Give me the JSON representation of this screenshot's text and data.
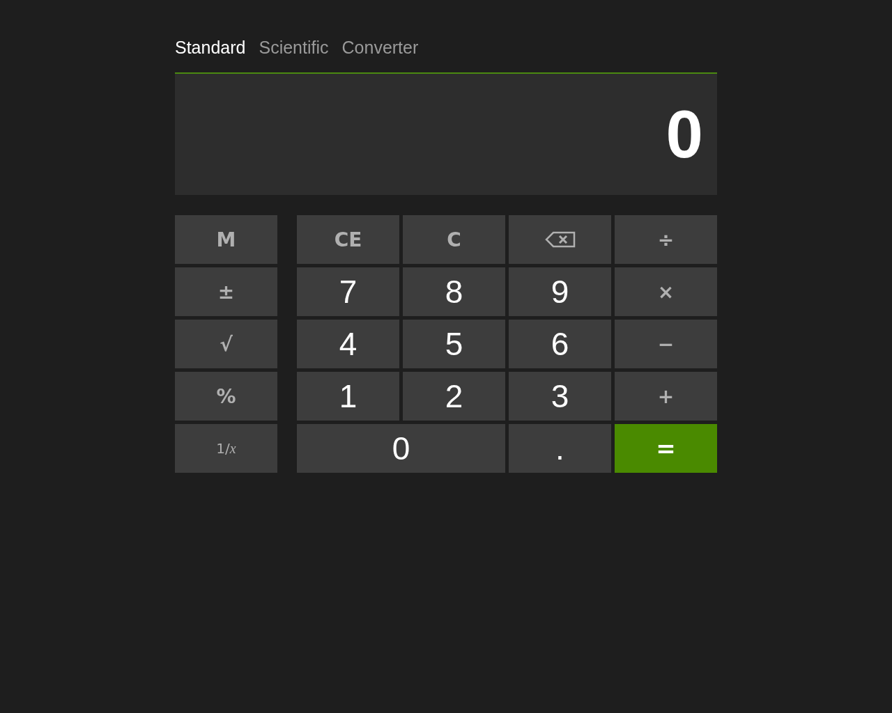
{
  "tabs": [
    {
      "label": "Standard",
      "selected": true
    },
    {
      "label": "Scientific",
      "selected": false
    },
    {
      "label": "Converter",
      "selected": false
    }
  ],
  "display": {
    "value": "0"
  },
  "memory_keys": [
    {
      "label": "M"
    },
    {
      "label": "±"
    },
    {
      "label": "√"
    },
    {
      "label": "%"
    },
    {
      "label": "1/*x*"
    }
  ],
  "keys": [
    {
      "label": "CE",
      "kind": "function"
    },
    {
      "label": "C",
      "kind": "function"
    },
    {
      "kind": "backspace"
    },
    {
      "label": "÷",
      "kind": "function"
    },
    {
      "label": "7",
      "kind": "digit"
    },
    {
      "label": "8",
      "kind": "digit"
    },
    {
      "label": "9",
      "kind": "digit"
    },
    {
      "label": "×",
      "kind": "function"
    },
    {
      "label": "4",
      "kind": "digit"
    },
    {
      "label": "5",
      "kind": "digit"
    },
    {
      "label": "6",
      "kind": "digit"
    },
    {
      "label": "−",
      "kind": "function"
    },
    {
      "label": "1",
      "kind": "digit"
    },
    {
      "label": "2",
      "kind": "digit"
    },
    {
      "label": "3",
      "kind": "digit"
    },
    {
      "label": "+",
      "kind": "function"
    },
    {
      "label": "0",
      "kind": "digit",
      "wide": true
    },
    {
      "label": ".",
      "kind": "digit"
    },
    {
      "label": "=",
      "kind": "equals"
    }
  ]
}
